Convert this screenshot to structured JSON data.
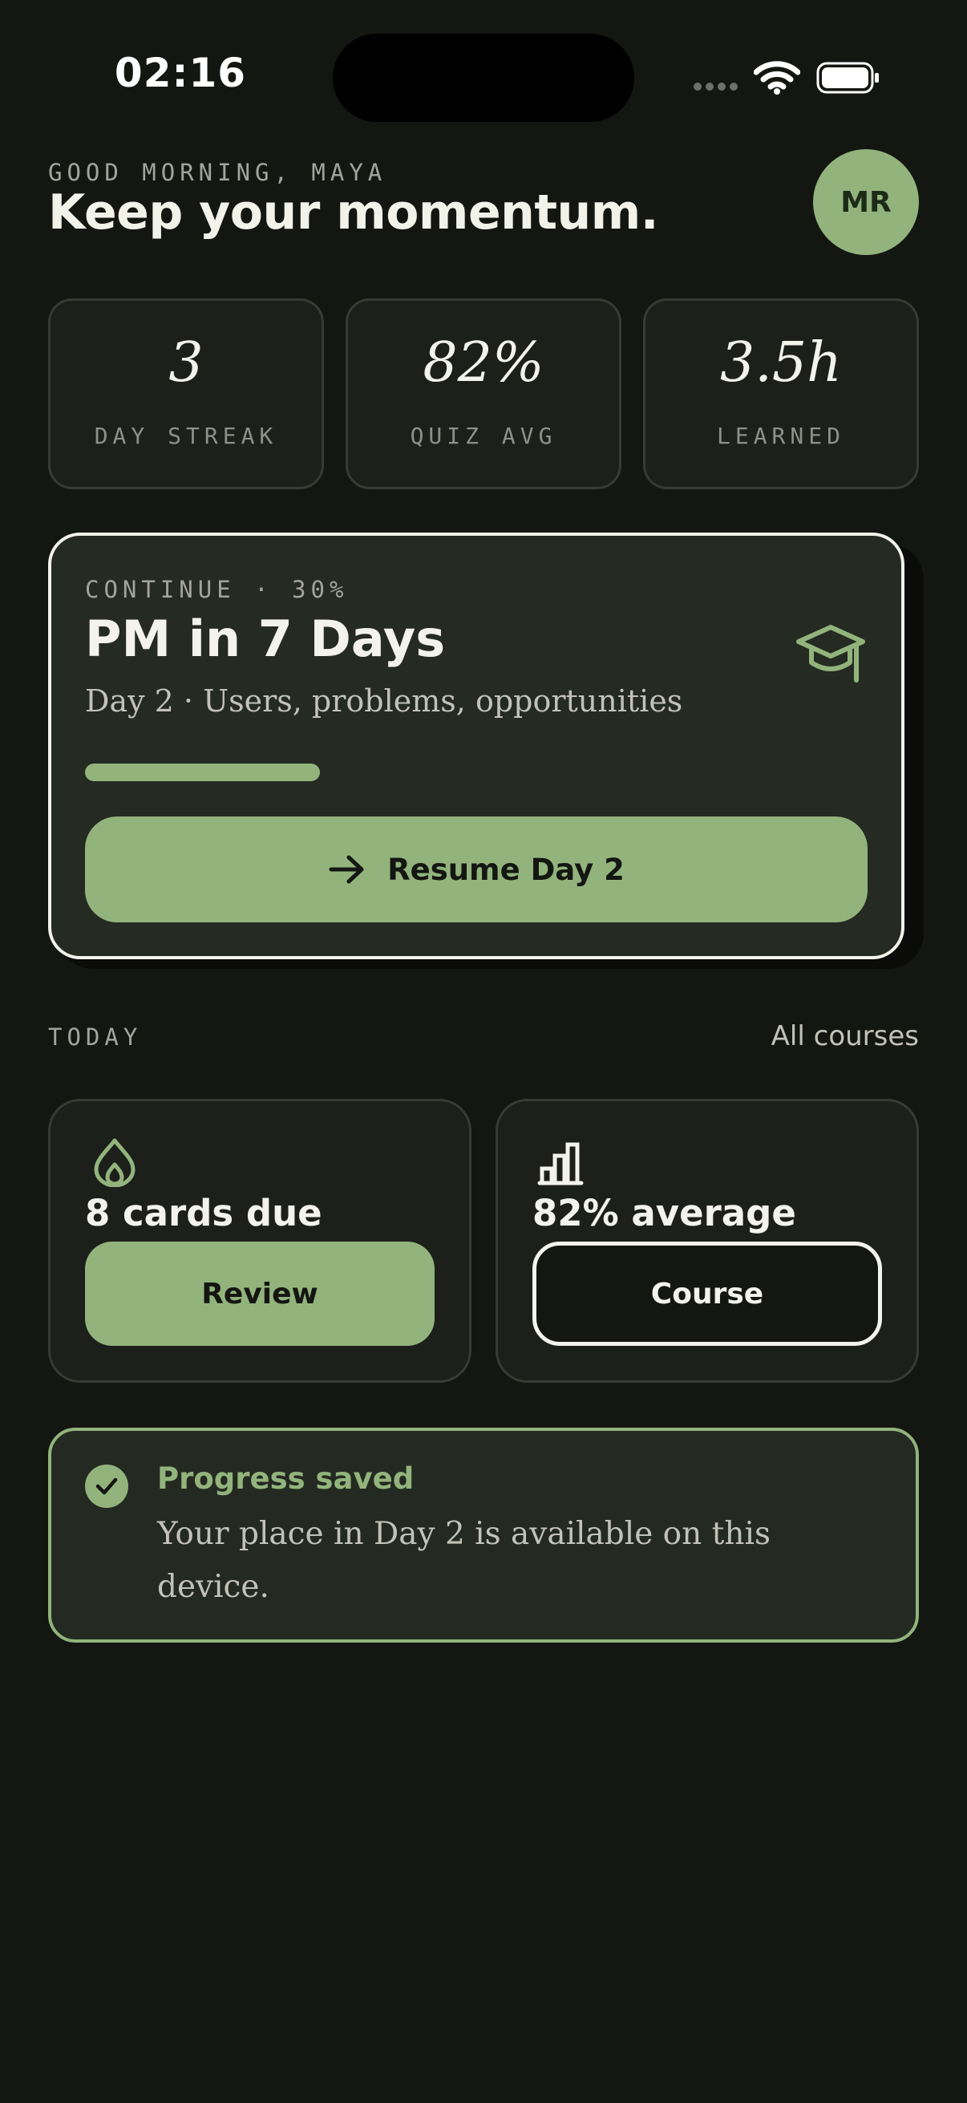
{
  "status_bar": {
    "time": "02:16"
  },
  "header": {
    "greeting": "GOOD MORNING, MAYA",
    "headline": "Keep your momentum.",
    "avatar_initials": "MR"
  },
  "stats": [
    {
      "value": "3",
      "label": "DAY STREAK"
    },
    {
      "value": "82%",
      "label": "QUIZ AVG"
    },
    {
      "value": "3.5h",
      "label": "LEARNED"
    }
  ],
  "continue_card": {
    "kicker": "CONTINUE · 30%",
    "title": "PM in 7 Days",
    "subtitle": "Day 2 · Users, problems, opportunities",
    "progress_fraction": 0.3,
    "icon": "graduation-cap-icon",
    "button_label": "Resume Day 2",
    "button_icon": "arrow-right-icon"
  },
  "today": {
    "label": "TODAY",
    "all_courses_link": "All courses",
    "cards": [
      {
        "icon": "flame-icon",
        "text": "8 cards due",
        "button_label": "Review"
      },
      {
        "icon": "bar-chart-icon",
        "text": "82% average",
        "button_label": "Course"
      }
    ]
  },
  "saved_banner": {
    "icon": "check-circle-icon",
    "title": "Progress saved",
    "body": "Your place in Day 2 is available on this device."
  },
  "colors": {
    "background": "#141612",
    "accent": "#92b47c",
    "card": "#1d1f1b",
    "text": "#f3f2ec"
  }
}
